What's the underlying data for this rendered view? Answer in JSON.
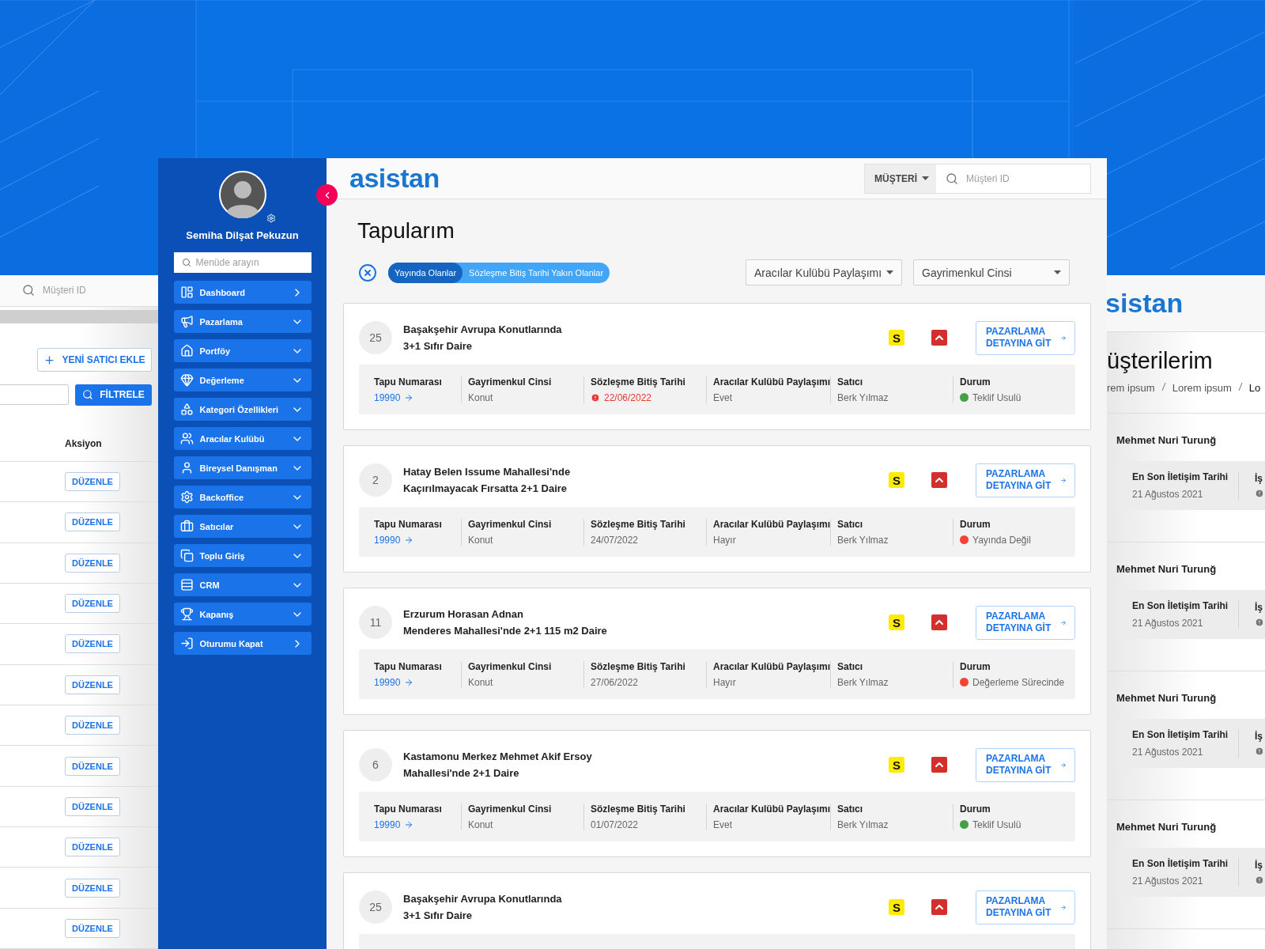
{
  "left_screen": {
    "search": {
      "placeholder": "Müşteri ID"
    },
    "add_button": "YENİ SATICI EKLE",
    "filter_button": "FİLTRELE",
    "column_header": "Aksiyon",
    "rows": [
      {
        "action": "DÜZENLE"
      },
      {
        "action": "DÜZENLE"
      },
      {
        "action": "DÜZENLE"
      },
      {
        "action": "DÜZENLE"
      },
      {
        "action": "DÜZENLE"
      },
      {
        "action": "DÜZENLE"
      },
      {
        "action": "DÜZENLE"
      },
      {
        "action": "DÜZENLE"
      },
      {
        "action": "DÜZENLE"
      },
      {
        "action": "DÜZENLE"
      },
      {
        "action": "DÜZENLE"
      },
      {
        "action": "DÜZENLE"
      }
    ]
  },
  "sidebar": {
    "user_name": "Semiha Dilşat Pekuzun",
    "search": {
      "placeholder": "Menüde arayın"
    },
    "items": [
      {
        "label": "Dashboard",
        "kind": "link"
      },
      {
        "label": "Pazarlama",
        "kind": "group"
      },
      {
        "label": "Portföy",
        "kind": "group"
      },
      {
        "label": "Değerleme",
        "kind": "group"
      },
      {
        "label": "Kategori Özellikleri",
        "kind": "group"
      },
      {
        "label": "Aracılar Kulübü",
        "kind": "group"
      },
      {
        "label": "Bireysel Danışman",
        "kind": "group"
      },
      {
        "label": "Backoffice",
        "kind": "group"
      },
      {
        "label": "Satıcılar",
        "kind": "group"
      },
      {
        "label": "Toplu Giriş",
        "kind": "group"
      },
      {
        "label": "CRM",
        "kind": "group"
      },
      {
        "label": "Kapanış",
        "kind": "group"
      },
      {
        "label": "Oturumu Kapat",
        "kind": "link"
      }
    ]
  },
  "header": {
    "logo": "asistan",
    "type_select": "MÜŞTERİ",
    "search": {
      "placeholder": "Müşteri ID"
    }
  },
  "page_title": "Tapularım",
  "filters": {
    "chips": [
      {
        "label": "Yayında Olanlar",
        "selected": true
      },
      {
        "label": "Sözleşme Bitiş Tarihi Yakın Olanlar",
        "selected": false
      }
    ],
    "selects": [
      "Aracılar Kulübü Paylaşımı",
      "Gayrimenkul Cinsi"
    ]
  },
  "cards": [
    {
      "number": "25",
      "title_lines": [
        "Başakşehir Avrupa Konutlarında",
        "3+1 Sıfır Daire"
      ],
      "badge": "S",
      "button": "PAZARLAMA DETAYINA GİT",
      "details": [
        {
          "kind": "link",
          "label": "Tapu Numarası",
          "value": "19990"
        },
        {
          "kind": "text",
          "label": "Gayrimenkul Cinsi",
          "value": "Konut"
        },
        {
          "kind": "date",
          "label": "Sözleşme Bitiş Tarihi",
          "value": "22/06/2022",
          "warning": true
        },
        {
          "kind": "text",
          "label": "Aracılar Kulübü Paylaşımı",
          "value": "Evet"
        },
        {
          "kind": "text",
          "label": "Satıcı",
          "value": "Berk Yılmaz"
        },
        {
          "kind": "status",
          "label": "Durum",
          "value": "Teklif Usulü",
          "color": "#43a047"
        }
      ]
    },
    {
      "number": "2",
      "title_lines": [
        "Hatay Belen Issume Mahallesi'nde",
        "Kaçırılmayacak Fırsatta 2+1 Daire"
      ],
      "badge": "S",
      "button": "PAZARLAMA DETAYINA GİT",
      "details": [
        {
          "kind": "link",
          "label": "Tapu Numarası",
          "value": "19990"
        },
        {
          "kind": "text",
          "label": "Gayrimenkul Cinsi",
          "value": "Konut"
        },
        {
          "kind": "date",
          "label": "Sözleşme Bitiş Tarihi",
          "value": "24/07/2022",
          "warning": false
        },
        {
          "kind": "text",
          "label": "Aracılar Kulübü Paylaşımı",
          "value": "Hayır"
        },
        {
          "kind": "text",
          "label": "Satıcı",
          "value": "Berk Yılmaz"
        },
        {
          "kind": "status",
          "label": "Durum",
          "value": "Yayında Değil",
          "color": "#f44336"
        }
      ]
    },
    {
      "number": "11",
      "title_lines": [
        "Erzurum Horasan Adnan",
        "Menderes Mahallesi'nde 2+1 115 m2 Daire"
      ],
      "badge": "S",
      "button": "PAZARLAMA DETAYINA GİT",
      "details": [
        {
          "kind": "link",
          "label": "Tapu Numarası",
          "value": "19990"
        },
        {
          "kind": "text",
          "label": "Gayrimenkul Cinsi",
          "value": "Konut"
        },
        {
          "kind": "date",
          "label": "Sözleşme Bitiş Tarihi",
          "value": "27/06/2022",
          "warning": false
        },
        {
          "kind": "text",
          "label": "Aracılar Kulübü Paylaşımı",
          "value": "Hayır"
        },
        {
          "kind": "text",
          "label": "Satıcı",
          "value": "Berk Yılmaz"
        },
        {
          "kind": "status",
          "label": "Durum",
          "value": "Değerleme Sürecinde",
          "color": "#f44336"
        }
      ]
    },
    {
      "number": "6",
      "title_lines": [
        "Kastamonu Merkez Mehmet Akif Ersoy",
        "Mahallesi'nde 2+1 Daire"
      ],
      "badge": "S",
      "button": "PAZARLAMA DETAYINA GİT",
      "details": [
        {
          "kind": "link",
          "label": "Tapu Numarası",
          "value": "19990"
        },
        {
          "kind": "text",
          "label": "Gayrimenkul Cinsi",
          "value": "Konut"
        },
        {
          "kind": "date",
          "label": "Sözleşme Bitiş Tarihi",
          "value": "01/07/2022",
          "warning": false
        },
        {
          "kind": "text",
          "label": "Aracılar Kulübü Paylaşımı",
          "value": "Evet"
        },
        {
          "kind": "text",
          "label": "Satıcı",
          "value": "Berk Yılmaz"
        },
        {
          "kind": "status",
          "label": "Durum",
          "value": "Teklif Usulü",
          "color": "#43a047"
        }
      ]
    },
    {
      "number": "25",
      "title_lines": [
        "Başakşehir Avrupa Konutlarında",
        "3+1 Sıfır Daire"
      ],
      "badge": "S",
      "button": "PAZARLAMA DETAYINA GİT"
    }
  ],
  "right_screen": {
    "logo": "sistan",
    "title": "üşterilerim",
    "breadcrumb": [
      "rem ipsum",
      "Lorem ipsum",
      "Lo"
    ],
    "cards": [
      {
        "name": "Mehmet Nuri Turunğ",
        "label": "En Son İletişim Tarihi",
        "date": "21 Ağustos 2021",
        "column_2": "İş"
      },
      {
        "name": "Mehmet Nuri Turunğ",
        "label": "En Son İletişim Tarihi",
        "date": "21 Ağustos 2021",
        "column_2": "İş"
      },
      {
        "name": "Mehmet Nuri Turunğ",
        "label": "En Son İletişim Tarihi",
        "date": "21 Ağustos 2021",
        "column_2": "İş"
      },
      {
        "name": "Mehmet Nuri Turunğ",
        "label": "En Son İletişim Tarihi",
        "date": "21 Ağustos 2021",
        "column_2": "İş"
      }
    ]
  }
}
